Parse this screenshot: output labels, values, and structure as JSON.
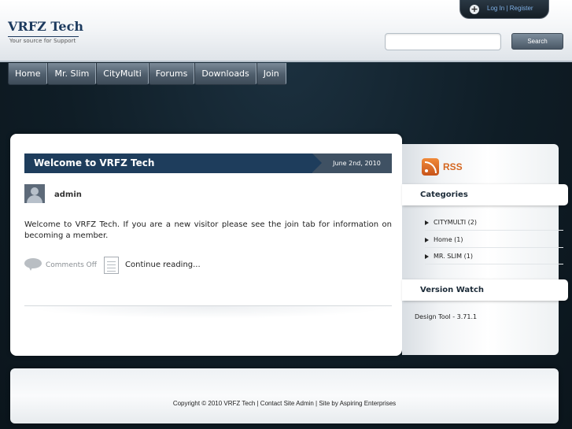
{
  "header": {
    "site_title": "VRFZ Tech",
    "tagline": "Your source for Support",
    "login_label": "Log In | Register",
    "search_placeholder": "",
    "search_button": "Search"
  },
  "nav": {
    "items": [
      {
        "label": "Home"
      },
      {
        "label": "Mr. Slim"
      },
      {
        "label": "CityMulti"
      },
      {
        "label": "Forums"
      },
      {
        "label": "Downloads"
      },
      {
        "label": "Join"
      }
    ]
  },
  "post": {
    "title": "Welcome to VRFZ Tech",
    "date": "June 2nd, 2010",
    "author": "admin",
    "body": "Welcome to VRFZ Tech. If you are a new visitor please see the join tab for information on becoming a member.",
    "comments": "Comments Off",
    "continue": "Continue reading..."
  },
  "sidebar": {
    "rss_label": "RSS",
    "categories_title": "Categories",
    "categories": [
      {
        "label": "CITYMULTI",
        "count": "(2)"
      },
      {
        "label": "Home",
        "count": "(1)"
      },
      {
        "label": "MR. SLIM",
        "count": "(1)"
      }
    ],
    "version_title": "Version Watch",
    "version_text": "Design Tool - 3.71.1"
  },
  "footer": {
    "text": "Copyright © 2010 VRFZ Tech | Contact Site Admin | Site by Aspiring Enterprises"
  },
  "colors": {
    "brand_navy": "#1c3a5e",
    "post_bar": "#1e3d5c",
    "date_bar": "#3f5163",
    "rss_orange": "#d5661f",
    "page_background": "#0f1d26"
  },
  "icons": {
    "login": "plus-circle-icon",
    "avatar": "user-avatar-icon",
    "comments": "speech-bubble-icon",
    "continue": "document-icon",
    "rss": "rss-feed-icon",
    "category_bullet": "triangle-right-icon"
  }
}
